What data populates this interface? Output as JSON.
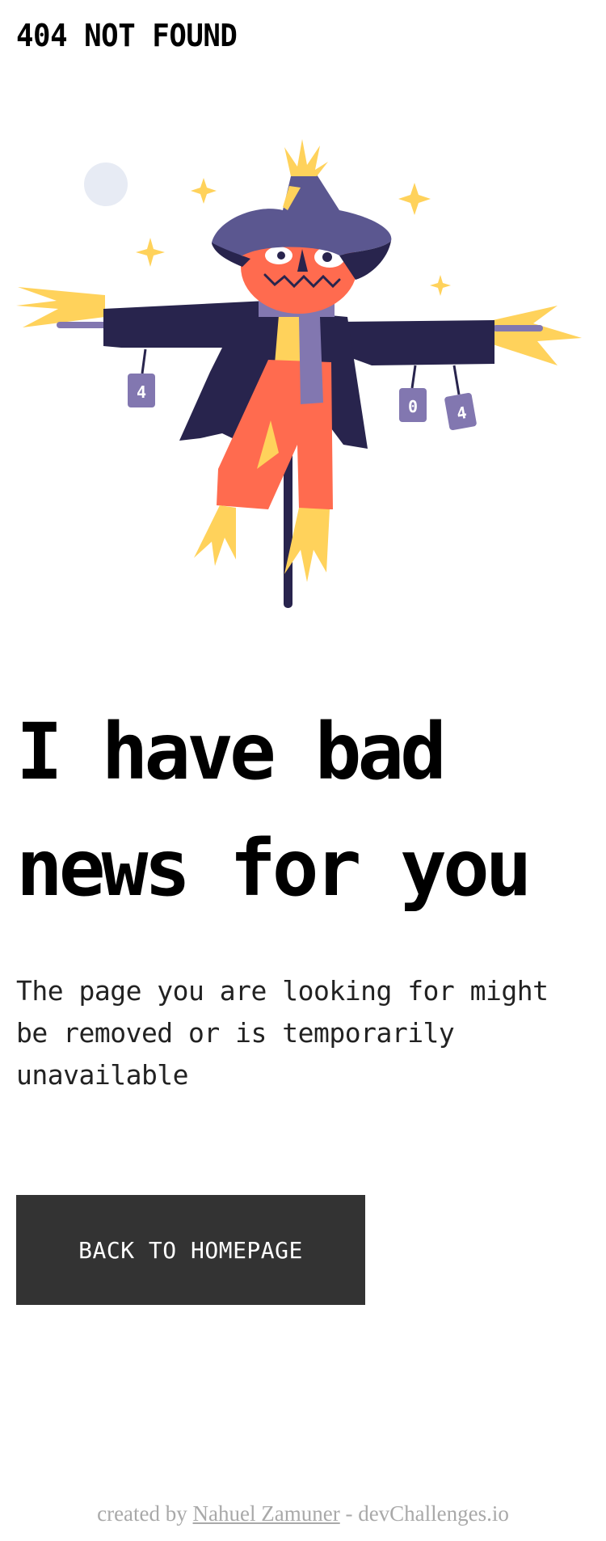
{
  "header": {
    "logo_text": "404 NOT FOUND"
  },
  "illustration": {
    "subject": "scarecrow",
    "can_labels": [
      "4",
      "0",
      "4"
    ],
    "colors": {
      "hat": "#5B5790",
      "coat": "#28244D",
      "face": "#FF6B4F",
      "straw": "#FFD25B",
      "scarf": "#8277B0",
      "moon": "#E7EBF4"
    }
  },
  "main": {
    "headline": "I have bad news for you",
    "description": "The page you are looking for might be removed or is temporarily unavailable",
    "button_label": "BACK TO HOMEPAGE"
  },
  "footer": {
    "prefix": "created by",
    "author": "Nahuel Zamuner",
    "suffix": "- devChallenges.io"
  }
}
